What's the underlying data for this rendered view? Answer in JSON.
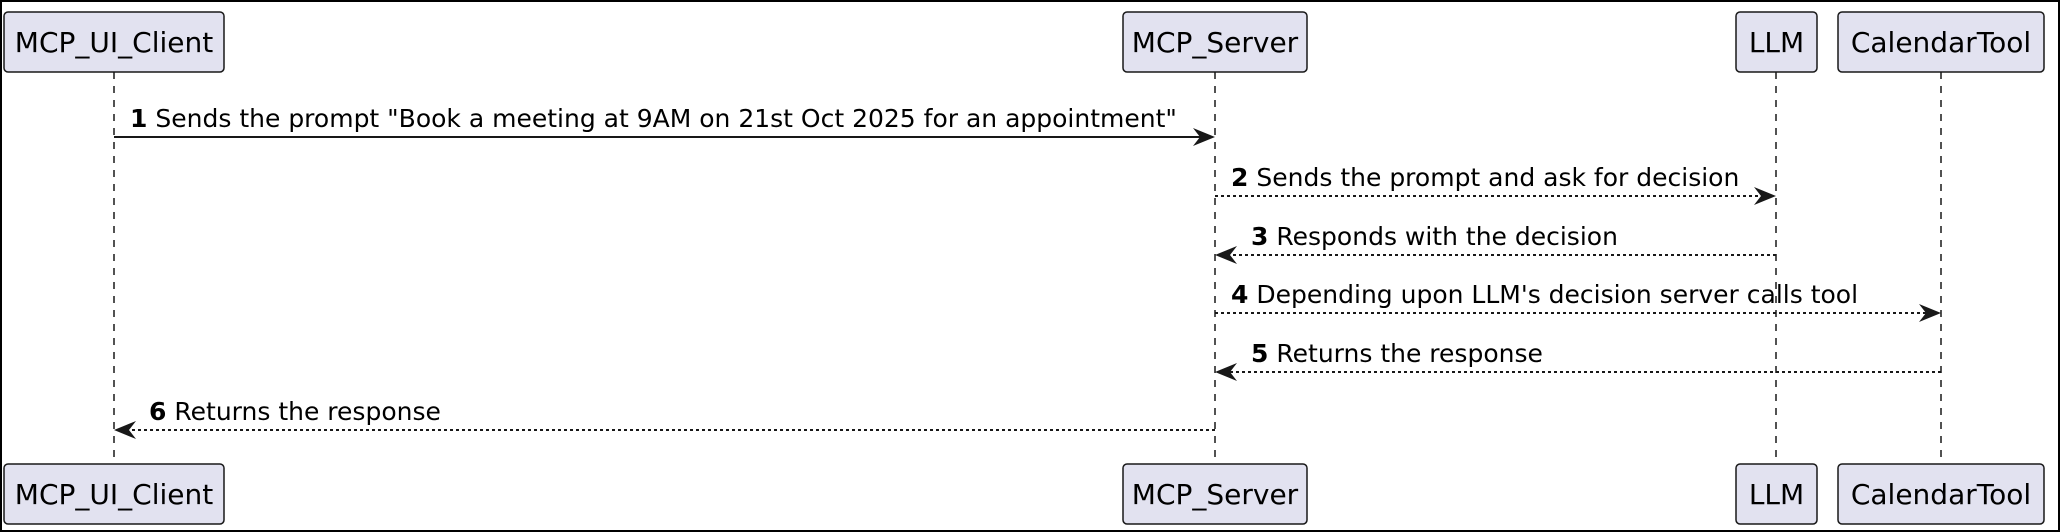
{
  "participants": [
    {
      "id": "client",
      "label": "MCP_UI_Client"
    },
    {
      "id": "server",
      "label": "MCP_Server"
    },
    {
      "id": "llm",
      "label": "LLM"
    },
    {
      "id": "tool",
      "label": "CalendarTool"
    }
  ],
  "messages": [
    {
      "num": "1",
      "text": "Sends the prompt \"Book a meeting at 9AM on 21st Oct 2025 for an appointment\"",
      "from": "client",
      "to": "server",
      "style": "solid"
    },
    {
      "num": "2",
      "text": "Sends the prompt and ask for decision",
      "from": "server",
      "to": "llm",
      "style": "dashed"
    },
    {
      "num": "3",
      "text": "Responds with the decision",
      "from": "llm",
      "to": "server",
      "style": "dashed"
    },
    {
      "num": "4",
      "text": "Depending upon LLM's decision server calls tool",
      "from": "server",
      "to": "tool",
      "style": "dashed"
    },
    {
      "num": "5",
      "text": "Returns the response",
      "from": "tool",
      "to": "server",
      "style": "dashed"
    },
    {
      "num": "6",
      "text": "Returns the response",
      "from": "server",
      "to": "client",
      "style": "dashed"
    }
  ]
}
